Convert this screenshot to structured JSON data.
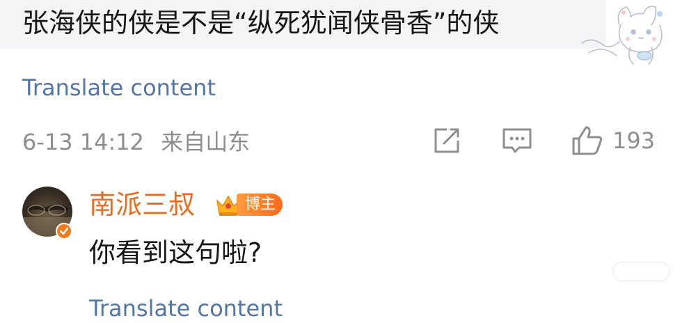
{
  "comment": {
    "text": "张海侠的侠是不是“纵死犹闻侠骨香”的侠",
    "translate_label": "Translate content",
    "meta": {
      "time": "6-13 14:12",
      "location": "来自山东"
    },
    "actions": {
      "like_count": "193"
    }
  },
  "reply": {
    "author": "南派三叔",
    "badge": "博主",
    "text": "你看到这句啦?",
    "translate_label": "Translate content"
  },
  "colors": {
    "link": "#5476a4",
    "meta": "#8e8e8e",
    "author": "#e86c1f",
    "bubble_bg": "#f4f3f6"
  },
  "icons": {
    "share": "share-icon",
    "comment": "comment-icon",
    "like": "thumbs-up-icon",
    "crown": "crown-icon",
    "verified": "verified-badge-icon",
    "sticker": "cat-sticker"
  }
}
